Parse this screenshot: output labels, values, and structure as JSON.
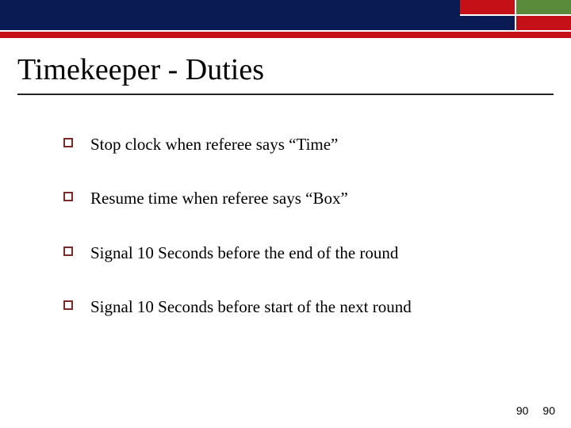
{
  "title": "Timekeeper - Duties",
  "bullets": [
    "Stop clock when referee says “Time”",
    "Resume time when referee says “Box”",
    "Signal 10 Seconds before the end of the round",
    "Signal 10 Seconds before start of the next round"
  ],
  "page_number_left": "90",
  "page_number_right": "90",
  "colors": {
    "navy": "#0a1b54",
    "red": "#c61017",
    "green": "#5a8b3a",
    "bullet_border": "#7b2a2a"
  }
}
